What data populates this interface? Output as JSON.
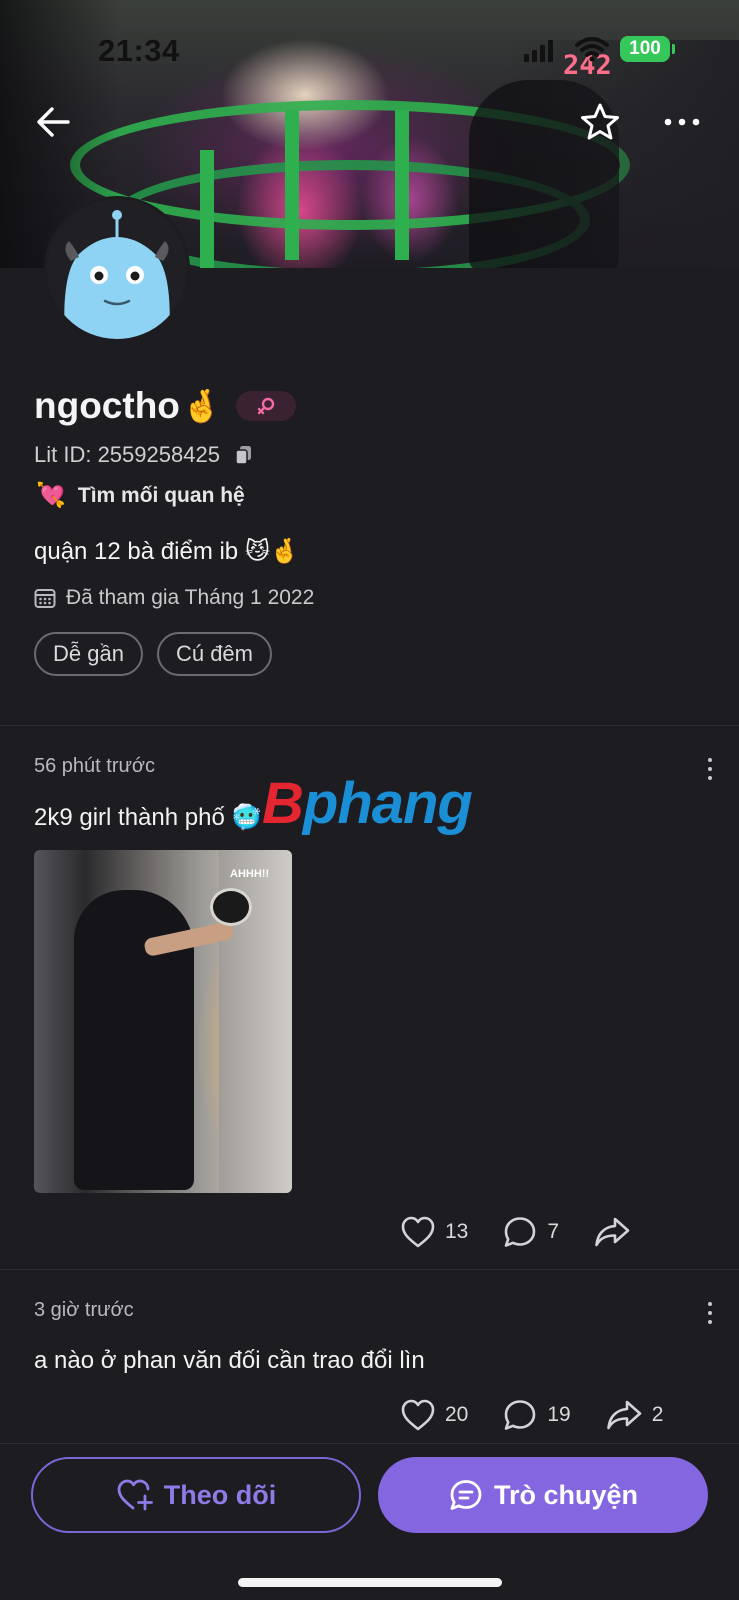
{
  "status_bar": {
    "time": "21:34",
    "battery": "100",
    "cover_overlay_text": "242"
  },
  "header": {
    "back_icon": "arrow-left-icon",
    "star_icon": "star-outline-icon",
    "more_icon": "more-horizontal-icon"
  },
  "profile": {
    "username": "ngoctho",
    "username_emoji": "🤞",
    "gender_icon": "female-symbol-icon",
    "lit_id_label": "Lit ID: 2559258425",
    "relationship_emoji": "💘",
    "relationship": "Tìm mối quan hệ",
    "bio": "quận 12 bà điểm ib 😼🤞",
    "joined": "Đã tham gia Tháng 1 2022",
    "tags": [
      "Dễ gần",
      "Cú đêm"
    ]
  },
  "posts": [
    {
      "time": "56 phút trước",
      "text": "2k9 girl thành phố 🥶",
      "image_caption": "AHHH!!",
      "likes": "13",
      "comments": "7",
      "shares": ""
    },
    {
      "time": "3 giờ trước",
      "text": "a nào ở phan văn đối cần trao đổi lìn",
      "likes": "20",
      "comments": "19",
      "shares": "2"
    }
  ],
  "watermark": {
    "first": "B",
    "rest": "phang"
  },
  "actions": {
    "follow_label": "Theo dõi",
    "chat_label": "Trò chuyện"
  },
  "colors": {
    "background": "#1d1c21",
    "accent": "#8466e0",
    "accent_text": "#8f7ae6",
    "battery": "#35c759",
    "gender_pink": "#f26aa5"
  }
}
